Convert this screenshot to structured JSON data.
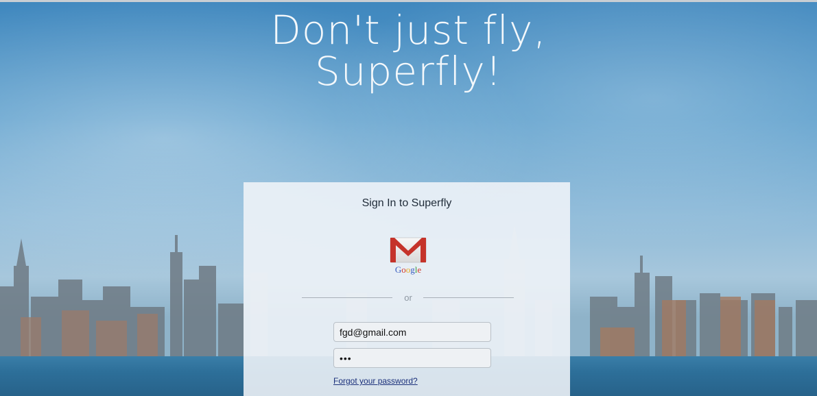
{
  "hero": {
    "line1": "Don't just fly,",
    "line2": "Superfly!"
  },
  "signin": {
    "title": "Sign In to Superfly",
    "google_button_label": "Google",
    "or_text": "or",
    "email_value": "fgd@gmail.com",
    "password_value": "•••",
    "forgot_link": "Forgot your password?"
  },
  "colors": {
    "sky": "#4a91c4",
    "link": "#1a2f7a",
    "gmail_red": "#c5332a"
  }
}
